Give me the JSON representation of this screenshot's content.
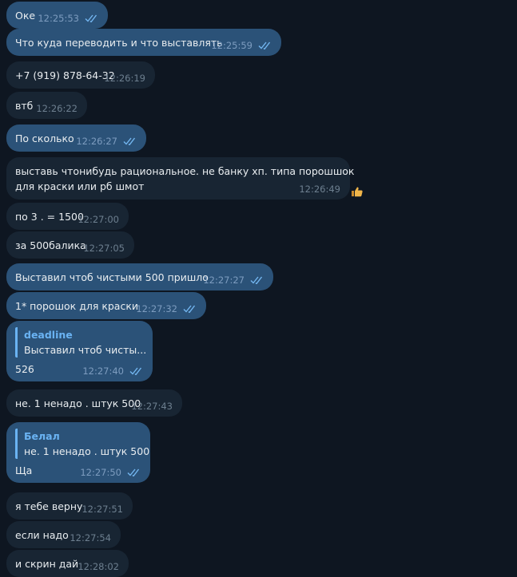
{
  "messages": [
    {
      "text": "Оке",
      "time": "12:25:53",
      "out": true
    },
    {
      "text": "Что куда переводить и что выставлять",
      "time": "12:25:59",
      "out": true
    },
    {
      "text": "+7 (919) 878-64-32",
      "time": "12:26:19",
      "out": false
    },
    {
      "text": "втб",
      "time": "12:26:22",
      "out": false
    },
    {
      "text": "По сколько",
      "time": "12:26:27",
      "out": true
    },
    {
      "text_line1": "выставь чтонибудь рациональное. не банку хп. типа порошшок",
      "text_line2": "для краски или рб шмот",
      "time": "12:26:49",
      "out": false,
      "reaction": "thumbs-up"
    },
    {
      "text": "по 3 . = 1500",
      "time": "12:27:00",
      "out": false
    },
    {
      "text": "за 500балика",
      "time": "12:27:05",
      "out": false
    },
    {
      "text": "Выставил чтоб чистыми 500 пришло",
      "time": "12:27:27",
      "out": true
    },
    {
      "text": "1* порошок для краски",
      "time": "12:27:32",
      "out": true
    },
    {
      "reply_author": "deadline",
      "reply_text": "Выставил чтоб чисты...",
      "text": "526",
      "time": "12:27:40",
      "out": true
    },
    {
      "text": "не. 1 ненадо . штук 500",
      "time": "12:27:43",
      "out": false
    },
    {
      "reply_author": "Белал",
      "reply_text": "не. 1 ненадо . штук 500",
      "text": "Ща",
      "time": "12:27:50",
      "out": true
    },
    {
      "text": "я тебе верну",
      "time": "12:27:51",
      "out": false
    },
    {
      "text": "если надо",
      "time": "12:27:54",
      "out": false
    },
    {
      "text": "и скрин дай",
      "time": "12:28:02",
      "out": false
    }
  ],
  "colors": {
    "background": "#0e1621",
    "outgoing_bubble": "#2b5278",
    "incoming_bubble": "#182533",
    "accent": "#6ab3f3"
  }
}
